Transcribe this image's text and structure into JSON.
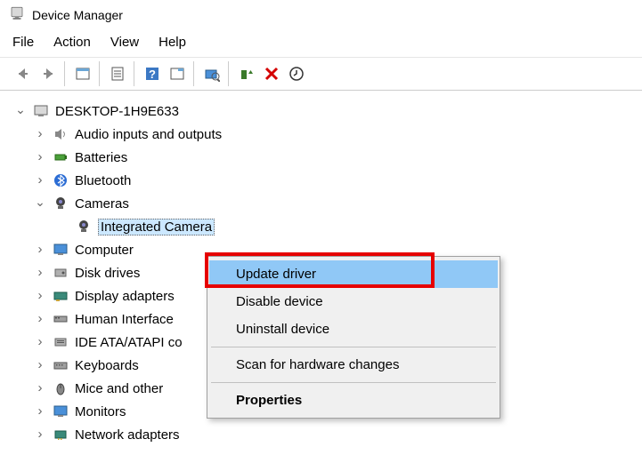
{
  "title": "Device Manager",
  "menu": {
    "file": "File",
    "action": "Action",
    "view": "View",
    "help": "Help"
  },
  "root": "DESKTOP-1H9E633",
  "categories": [
    {
      "label": "Audio inputs and outputs",
      "expanded": false
    },
    {
      "label": "Batteries",
      "expanded": false
    },
    {
      "label": "Bluetooth",
      "expanded": false
    },
    {
      "label": "Cameras",
      "expanded": true,
      "children": [
        "Integrated Camera"
      ]
    },
    {
      "label": "Computer",
      "expanded": false
    },
    {
      "label": "Disk drives",
      "expanded": false
    },
    {
      "label": "Display adapters",
      "expanded": false
    },
    {
      "label": "Human Interface",
      "expanded": false
    },
    {
      "label": "IDE ATA/ATAPI co",
      "expanded": false
    },
    {
      "label": "Keyboards",
      "expanded": false
    },
    {
      "label": "Mice and other",
      "expanded": false
    },
    {
      "label": "Monitors",
      "expanded": false
    },
    {
      "label": "Network adapters",
      "expanded": false
    }
  ],
  "context_menu": {
    "update": "Update driver",
    "disable": "Disable device",
    "uninstall": "Uninstall device",
    "scan": "Scan for hardware changes",
    "properties": "Properties"
  }
}
